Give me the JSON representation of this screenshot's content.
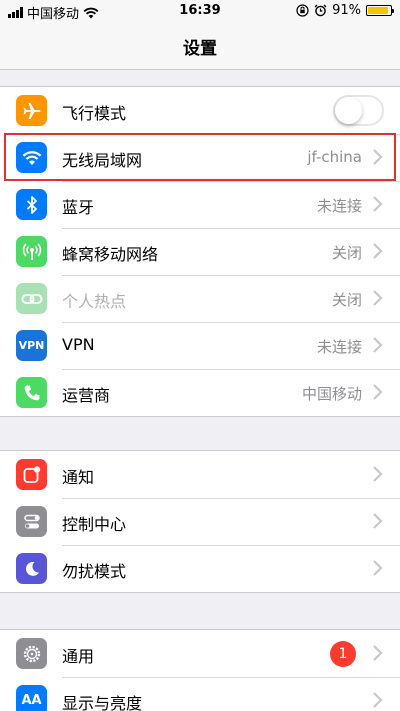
{
  "status_bar": {
    "carrier": "中国移动",
    "time": "16:39",
    "battery": "91%",
    "battery_level": 0.91
  },
  "nav": {
    "title": "设置"
  },
  "groups": [
    {
      "rows": [
        {
          "label": "飞行模式",
          "icon": "airplane-icon",
          "color": "#ff9500",
          "control": "toggle",
          "toggle_on": false
        },
        {
          "label": "无线局域网",
          "icon": "wifi-icon",
          "color": "#007aff",
          "value": "jf-china",
          "highlighted": true
        },
        {
          "label": "蓝牙",
          "icon": "bluetooth-icon",
          "color": "#007aff",
          "value": "未连接"
        },
        {
          "label": "蜂窝移动网络",
          "icon": "cellular-antenna-icon",
          "color": "#4cd964",
          "value": "关闭"
        },
        {
          "label": "个人热点",
          "icon": "hotspot-link-icon",
          "color": "#a8e1b4",
          "value": "关闭",
          "disabled": true
        },
        {
          "label": "VPN",
          "icon": "vpn-icon",
          "icon_text": "VPN",
          "color": "#1a73d9",
          "value": "未连接"
        },
        {
          "label": "运营商",
          "icon": "phone-icon",
          "color": "#4cd964",
          "value": "中国移动"
        }
      ]
    },
    {
      "rows": [
        {
          "label": "通知",
          "icon": "notifications-icon",
          "color": "#ff3b30"
        },
        {
          "label": "控制中心",
          "icon": "control-center-icon",
          "color": "#8e8e93"
        },
        {
          "label": "勿扰模式",
          "icon": "moon-icon",
          "color": "#5856d6"
        }
      ]
    },
    {
      "rows": [
        {
          "label": "通用",
          "icon": "gear-icon",
          "color": "#8e8e93",
          "badge": "1"
        },
        {
          "label": "显示与亮度",
          "icon": "display-brightness-icon",
          "icon_text": "AA",
          "color": "#007aff"
        }
      ]
    }
  ]
}
